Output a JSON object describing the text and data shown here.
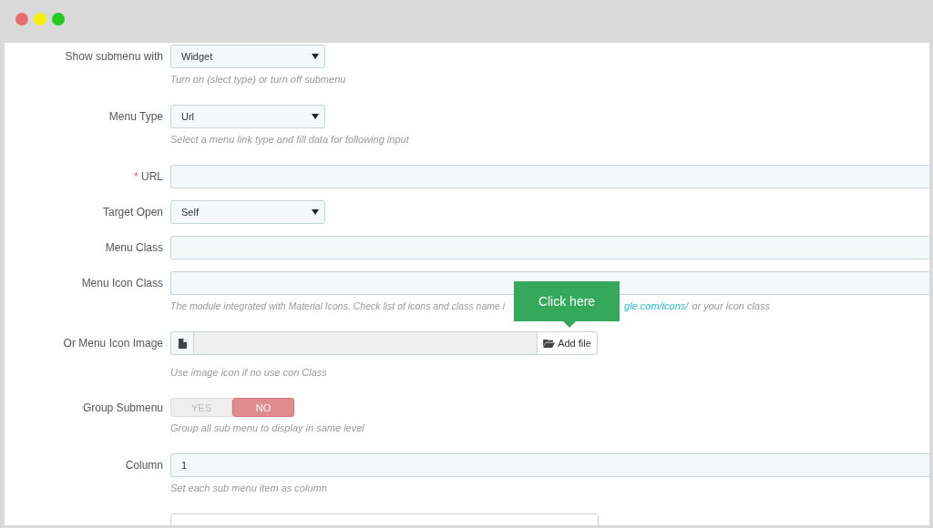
{
  "window": {
    "controls": [
      {
        "kind": "close"
      },
      {
        "kind": "minimize"
      },
      {
        "kind": "maximize"
      }
    ]
  },
  "fields": [
    {
      "kind": "select",
      "label": "Show submenu with",
      "value": "Widget",
      "help": "Turn on (slect type) or turn off submenu"
    },
    {
      "kind": "select",
      "label": "Menu Type",
      "value": "Url",
      "help": "Select a menu link type and fill data for following input"
    },
    {
      "kind": "text",
      "label": "URL",
      "required_mark": "*"
    },
    {
      "kind": "select",
      "label": "Target Open",
      "value": "Self"
    },
    {
      "kind": "text",
      "label": "Menu Class"
    },
    {
      "kind": "text",
      "label": "Menu Icon Class",
      "help": "The module integrated with Material Icons. Check list of icons and class name i",
      "help_link": "gle.com/icons/",
      "help_after": "or your icon class"
    },
    {
      "kind": "file",
      "label": "Or Menu Icon Image",
      "button": "Add file",
      "help": "Use image icon if no use con Class"
    },
    {
      "kind": "toggle",
      "label": "Group Submenu",
      "options": [
        {
          "label": "YES",
          "selected": false
        },
        {
          "label": "NO",
          "selected": true
        }
      ],
      "help": "Group all sub menu to display in same level"
    },
    {
      "kind": "text",
      "label": "Column",
      "value": "1",
      "help": "Set each sub menu item as column"
    },
    {
      "kind": "short"
    }
  ],
  "tooltip": {
    "text": "Click here"
  }
}
